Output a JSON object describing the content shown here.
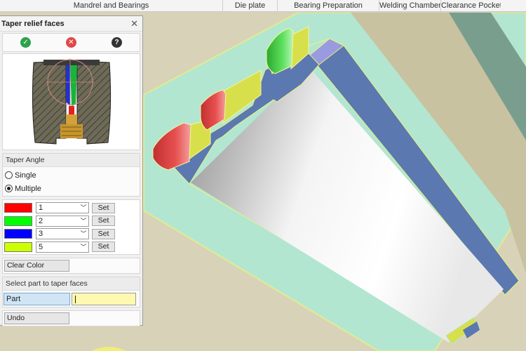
{
  "ribbon": {
    "tabs": [
      "Mandrel and Bearings",
      "Die plate",
      "Bearing Preparation",
      "Welding Chamber",
      "Clearance Pocket"
    ]
  },
  "panel": {
    "title": "Taper relief faces",
    "close_icon": "close-icon",
    "actions": {
      "ok_icon": "check-icon",
      "cancel_icon": "x-icon",
      "help_icon": "question-icon",
      "help_glyph": "?"
    },
    "taper_angle": {
      "header": "Taper Angle",
      "options": [
        "Single",
        "Multiple"
      ],
      "selected": "Multiple"
    },
    "colors": [
      {
        "swatch": "#ff0000",
        "value": "1",
        "set_label": "Set"
      },
      {
        "swatch": "#00ff00",
        "value": "2",
        "set_label": "Set"
      },
      {
        "swatch": "#0000ff",
        "value": "3",
        "set_label": "Set"
      },
      {
        "swatch": "#ccff00",
        "value": "5",
        "set_label": "Set"
      }
    ],
    "clear_color_label": "Clear Color",
    "select_part": {
      "header": "Select part to taper faces",
      "part_label": "Part",
      "input_value": ""
    },
    "undo_label": "Undo"
  },
  "colors": {
    "frame_green": "#b2e6d0",
    "wall_blue": "#5b78b0",
    "rim_yellow": "#d7e04a",
    "relief_red": "#dd4040",
    "relief_green": "#50d050",
    "background": "#d8d3b8"
  }
}
